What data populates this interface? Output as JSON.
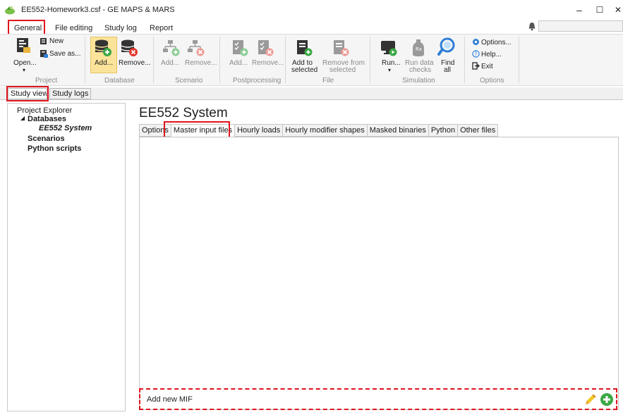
{
  "window": {
    "title": "EE552-Homework3.csf - GE MAPS & MARS",
    "controls": {
      "minimize": "–",
      "maximize": "☐",
      "close": "✕"
    }
  },
  "ribbon_tabs": [
    "General",
    "File editing",
    "Study log",
    "Report"
  ],
  "ribbon": {
    "project": {
      "label": "Project",
      "open": "Open...",
      "open_arrow": "▾",
      "new": "New",
      "save_as": "Save as..."
    },
    "database": {
      "label": "Database",
      "add": "Add...",
      "remove": "Remove..."
    },
    "scenario": {
      "label": "Scenario",
      "add": "Add...",
      "remove": "Remove..."
    },
    "postprocessing": {
      "label": "Postprocessing",
      "add": "Add...",
      "remove": "Remove..."
    },
    "file": {
      "label": "File",
      "add_to": "Add to",
      "add_to2": "selected",
      "remove_from": "Remove from",
      "remove_from2": "selected"
    },
    "simulation": {
      "label": "Simulation",
      "run": "Run...",
      "run_arrow": "▾",
      "run_data": "Run data",
      "run_data2": "checks",
      "find": "Find",
      "find2": "all"
    },
    "options": {
      "label": "Options",
      "options": "Options...",
      "help": "Help...",
      "exit": "Exit"
    }
  },
  "view_tabs": [
    "Study viewer",
    "Study logs"
  ],
  "explorer": {
    "root": "Project Explorer",
    "databases": "Databases",
    "db_item": "EE552 System",
    "scenarios": "Scenarios",
    "python": "Python scripts",
    "expand_glyph": "◢"
  },
  "main": {
    "title": "EE552 System",
    "tabs": [
      "Options",
      "Master input files",
      "Hourly loads",
      "Hourly modifier shapes",
      "Masked binaries",
      "Python",
      "Other files"
    ],
    "active_tab": "Master input files",
    "add_mif": "Add new MIF"
  },
  "colors": {
    "highlight": "#e0141e",
    "selected_button": "#fbe39a",
    "accent_blue": "#2f7fd6",
    "green": "#3aa845"
  }
}
